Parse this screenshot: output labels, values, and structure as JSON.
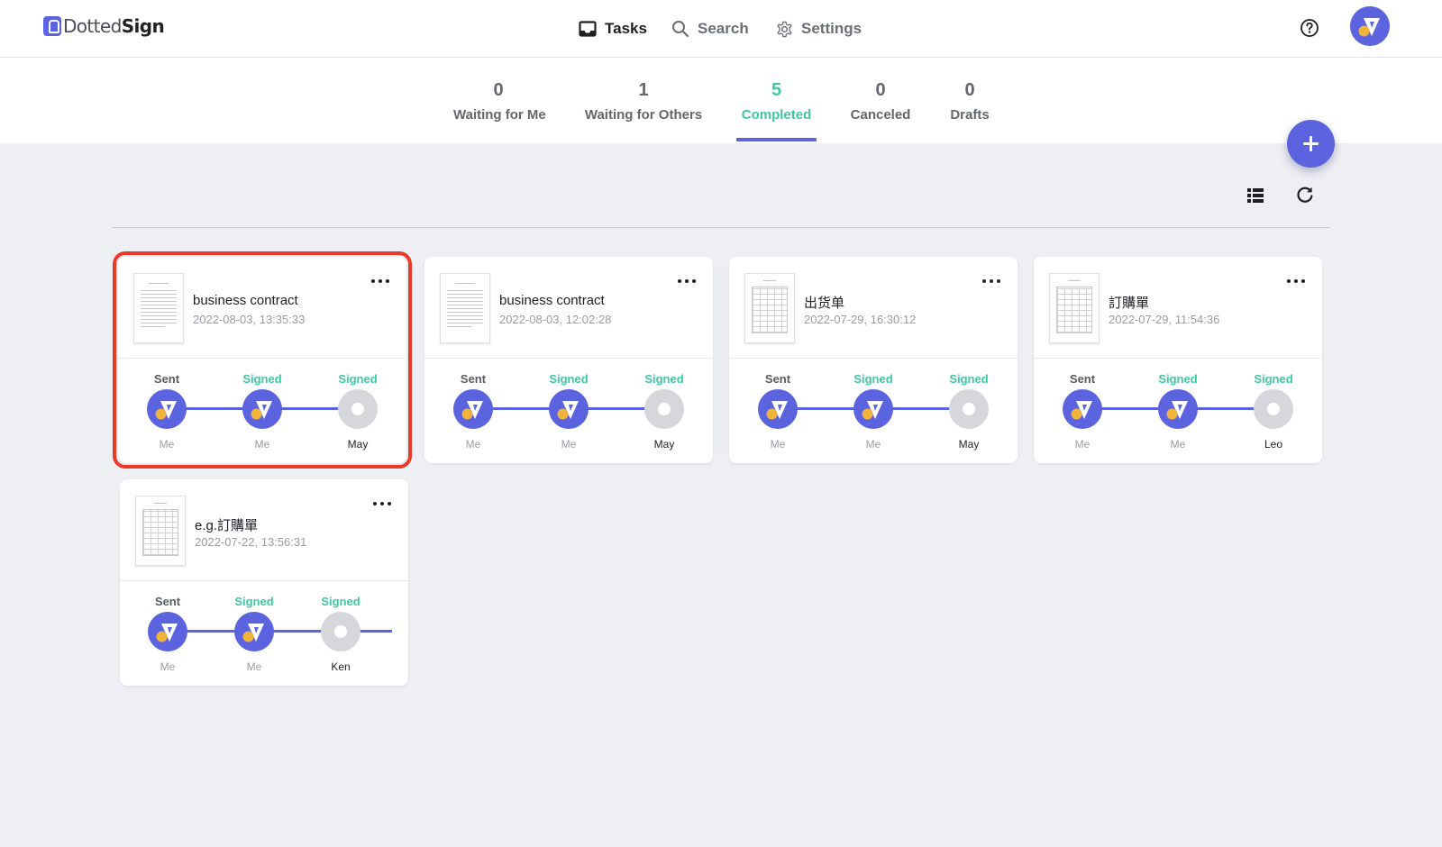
{
  "app": {
    "logo_prefix": "Dotted",
    "logo_suffix": "Sign"
  },
  "nav": {
    "tasks": "Tasks",
    "search": "Search",
    "settings": "Settings"
  },
  "tabs": [
    {
      "count": "0",
      "label": "Waiting for Me"
    },
    {
      "count": "1",
      "label": "Waiting for Others"
    },
    {
      "count": "5",
      "label": "Completed",
      "active": true
    },
    {
      "count": "0",
      "label": "Canceled"
    },
    {
      "count": "0",
      "label": "Drafts"
    }
  ],
  "colors": {
    "accent": "#5b63df",
    "signed": "#3ec7a2",
    "highlight": "#e83a26",
    "avatar_dot": "#f0b43c",
    "background": "#eeeff3"
  },
  "icons": {
    "tasks": "inbox-icon",
    "search": "search-icon",
    "settings": "gear-icon",
    "help": "help-circle-icon",
    "add": "plus-icon",
    "list_view": "list-view-icon",
    "refresh": "refresh-icon",
    "more": "more-horizontal-icon"
  },
  "cards": [
    {
      "title": "business contract",
      "date": "2022-08-03, 13:35:33",
      "thumb": "text",
      "highlighted": true,
      "steps": [
        {
          "status": "Sent",
          "name": "Me",
          "kind": "user"
        },
        {
          "status": "Signed",
          "name": "Me",
          "kind": "user"
        },
        {
          "status": "Signed",
          "name": "May",
          "kind": "pending"
        }
      ]
    },
    {
      "title": "business contract",
      "date": "2022-08-03, 12:02:28",
      "thumb": "text",
      "steps": [
        {
          "status": "Sent",
          "name": "Me",
          "kind": "user"
        },
        {
          "status": "Signed",
          "name": "Me",
          "kind": "user"
        },
        {
          "status": "Signed",
          "name": "May",
          "kind": "pending"
        }
      ]
    },
    {
      "title": "出货单",
      "date": "2022-07-29, 16:30:12",
      "thumb": "table",
      "steps": [
        {
          "status": "Sent",
          "name": "Me",
          "kind": "user"
        },
        {
          "status": "Signed",
          "name": "Me",
          "kind": "user"
        },
        {
          "status": "Signed",
          "name": "May",
          "kind": "pending"
        }
      ]
    },
    {
      "title": "訂購單",
      "date": "2022-07-29, 11:54:36",
      "thumb": "table",
      "steps": [
        {
          "status": "Sent",
          "name": "Me",
          "kind": "user"
        },
        {
          "status": "Signed",
          "name": "Me",
          "kind": "user"
        },
        {
          "status": "Signed",
          "name": "Leo",
          "kind": "pending"
        }
      ]
    },
    {
      "title": "e.g.訂購單",
      "date": "2022-07-22, 13:56:31",
      "thumb": "table",
      "steps": [
        {
          "status": "Sent",
          "name": "Me",
          "kind": "user"
        },
        {
          "status": "Signed",
          "name": "Me",
          "kind": "user"
        },
        {
          "status": "Signed",
          "name": "Ken",
          "kind": "pending"
        }
      ],
      "more_steps": true
    }
  ]
}
